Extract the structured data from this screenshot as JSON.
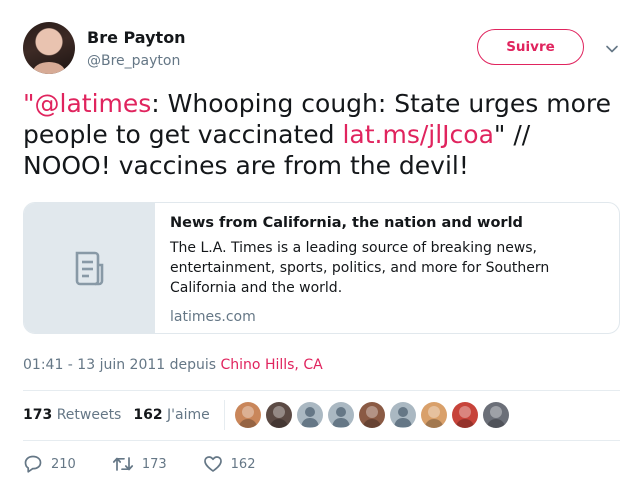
{
  "author": {
    "name": "Bre Payton",
    "handle": "@Bre_payton"
  },
  "follow_label": "Suivre",
  "tweet": {
    "mention": "\"@latimes",
    "text_1": ": Whooping cough: State urges more people to get vaccinated ",
    "link": "lat.ms/jlJcoa",
    "text_2": "\" // NOOO! vaccines are from the devil!"
  },
  "card": {
    "title": "News from California, the nation and world",
    "description": "The L.A. Times is a leading source of breaking news, entertainment, sports, politics, and more for Southern California and the world.",
    "domain": "latimes.com"
  },
  "meta": {
    "timestamp": "01:41 - 13 juin 2011 depuis ",
    "location": "Chino Hills, CA"
  },
  "stats": {
    "retweets_count": "173",
    "retweets_label": "Retweets",
    "likes_count": "162",
    "likes_label": "J'aime"
  },
  "liker_avatars": [
    "#c9865a",
    "#5b4a44",
    "#aab8c2",
    "#aab8c2",
    "#8a5a44",
    "#aab8c2",
    "#d9a06a",
    "#c7433a",
    "#6b6f78"
  ],
  "actions": {
    "replies": "210",
    "retweets": "173",
    "likes": "162"
  },
  "colors": {
    "accent": "#e0245e",
    "secondary_text": "#657786",
    "border": "#e1e8ed"
  },
  "icons": [
    "chevron-down-icon",
    "document-icon",
    "reply-icon",
    "retweet-icon",
    "heart-icon"
  ]
}
